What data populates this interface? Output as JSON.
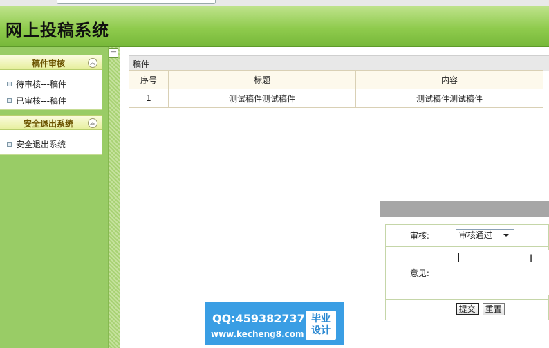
{
  "app": {
    "title": "网上投稿系统"
  },
  "sidebar": {
    "toggle_icon": "collapse-icon",
    "panels": [
      {
        "title": "稿件审核",
        "items": [
          "待审核---稿件",
          "已审核---稿件"
        ]
      },
      {
        "title": "安全退出系统",
        "items": [
          "安全退出系统"
        ]
      }
    ]
  },
  "content": {
    "section_title": "稿件",
    "table": {
      "headers": [
        "序号",
        "标题",
        "内容"
      ],
      "rows": [
        [
          "1",
          "测试稿件测试稿件",
          "测试稿件测试稿件"
        ]
      ]
    }
  },
  "dialog": {
    "review_label": "审核:",
    "review_value": "审核通过",
    "opinion_label": "意见:",
    "opinion_value": "",
    "submit_label": "提交",
    "reset_label": "重置"
  },
  "watermark": {
    "qq": "QQ:459382737",
    "url": "www.kecheng8.com",
    "badge_line1": "毕业",
    "badge_line2": "设计"
  },
  "colors": {
    "header": "#8fcb4d",
    "sidebar": "#99cc66",
    "watermark": "#3a9ee4"
  }
}
